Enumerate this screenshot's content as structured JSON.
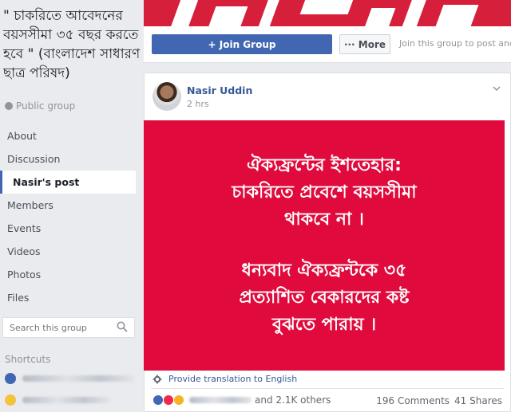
{
  "group": {
    "title": "\" চাকরিতে আবেদনের বয়সসীমা ৩৫ বছর করতে হবে \" (বাংলাদেশ সাধারণ ছাত্র পরিষদ)",
    "privacy": "Public group"
  },
  "nav": [
    "About",
    "Discussion",
    "Nasir's post",
    "Members",
    "Events",
    "Videos",
    "Photos",
    "Files"
  ],
  "search": {
    "placeholder": "Search this group"
  },
  "shortcuts": {
    "heading": "Shortcuts"
  },
  "actions": {
    "join_label": "+ Join Group",
    "more_label": "··· More",
    "hint": "Join this group to post and co"
  },
  "post": {
    "author": "Nasir Uddin",
    "time": "2 hrs",
    "image_lines_1": [
      "ঐক্যফ্রন্টের ইশতেহার:",
      "চাকরিতে প্রবেশে বয়সসীমা",
      "থাকবে না ।"
    ],
    "image_lines_2": [
      "ধন্যবাদ ঐক্যফ্রন্টকে ৩৫",
      "প্রত্যাশিত বেকারদের কষ্ট",
      "বুঝতে পারায় ।"
    ],
    "translation": "Provide translation to English",
    "reactions_text": "and 2.1K others",
    "comments": "196 Comments",
    "shares": "41 Shares"
  },
  "colors": {
    "brand": "#4267b2",
    "poster_bg": "#e00b3c",
    "link": "#365899"
  }
}
